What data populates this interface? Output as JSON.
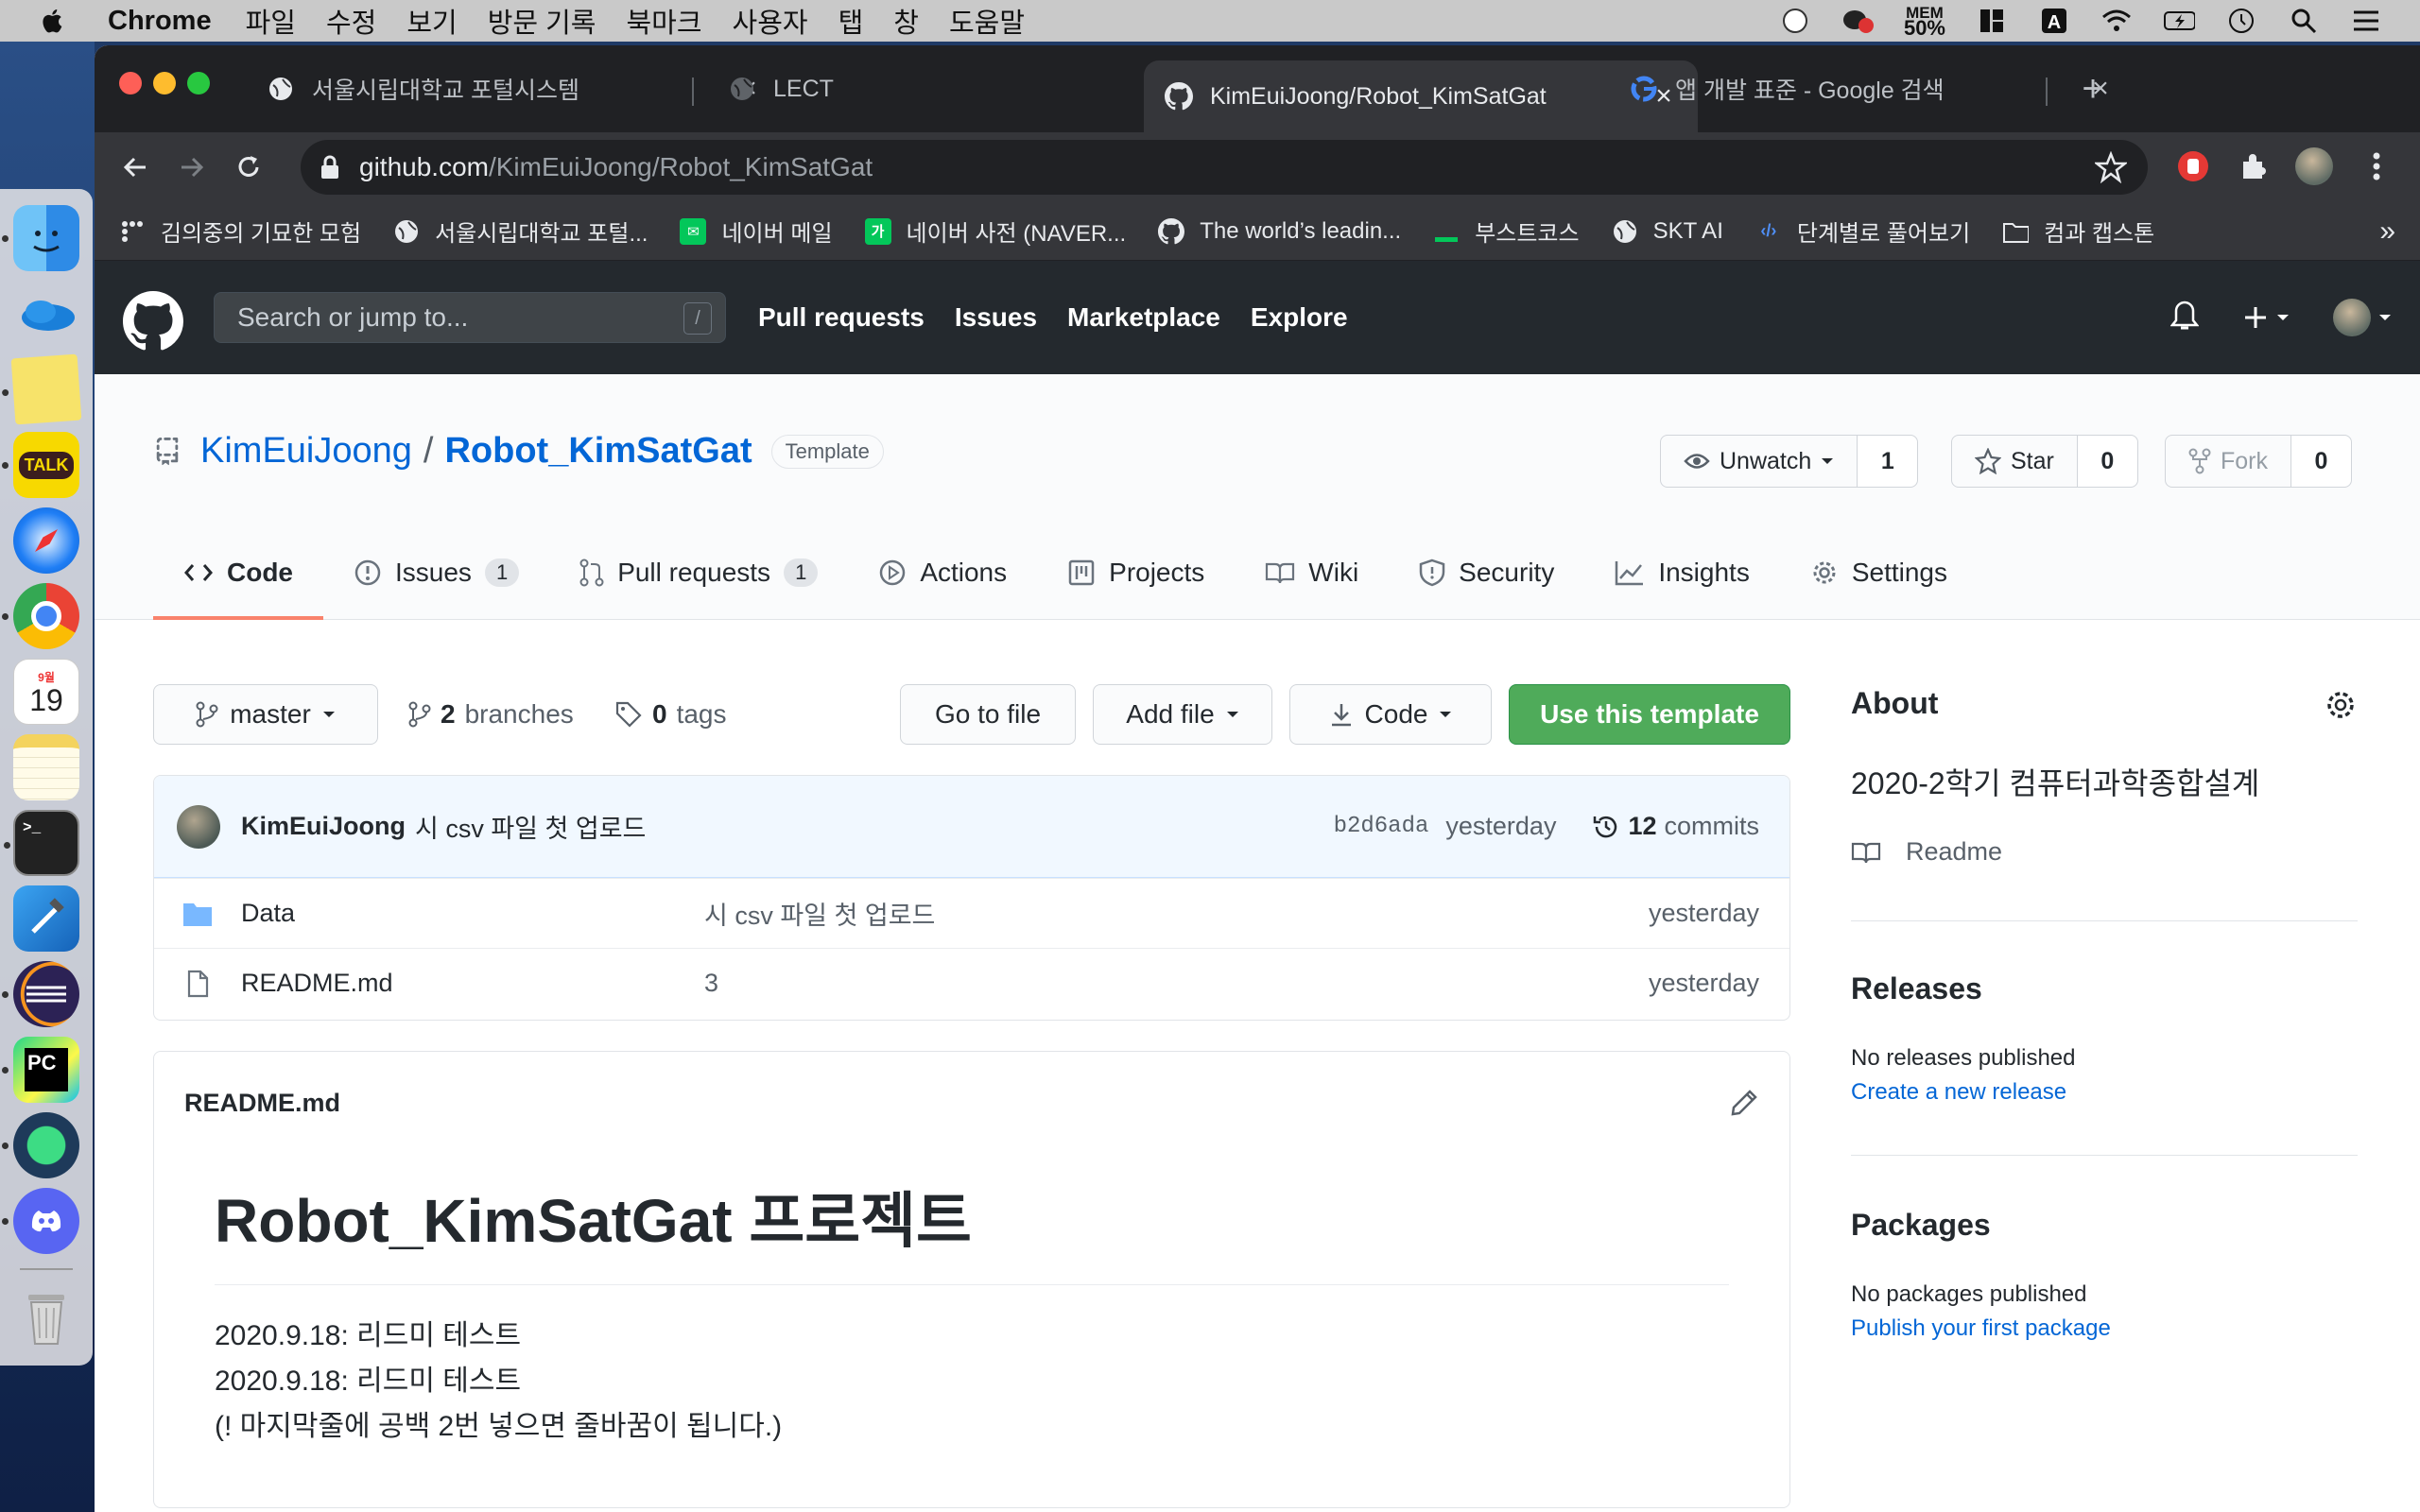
{
  "menubar": {
    "app": "Chrome",
    "items": [
      "파일",
      "수정",
      "보기",
      "방문 기록",
      "북마크",
      "사용자",
      "탭",
      "창",
      "도움말"
    ],
    "mem_label": "MEM",
    "mem_value": "50%"
  },
  "dock": {
    "apps": [
      "finder",
      "onedrive",
      "stickies",
      "kakaotalk",
      "safari",
      "chrome",
      "calendar",
      "notes",
      "terminal",
      "xcode",
      "eclipse",
      "pycharm",
      "android-studio",
      "discord",
      "trash"
    ],
    "calendar_month": "9월",
    "calendar_day": "19",
    "kakao_label": "TALK",
    "pycharm_label": "PC"
  },
  "tabs": [
    {
      "title": "서울시립대학교 포털시스템",
      "icon": "globe-icon"
    },
    {
      "title": "LECT",
      "icon": "globe-icon"
    },
    {
      "title": "KimEuiJoong/Robot_KimSatGat",
      "icon": "github-icon",
      "active": true
    },
    {
      "title": "앱 개발 표준 - Google 검색",
      "icon": "google-icon"
    }
  ],
  "address": {
    "host": "github.com",
    "path": "/KimEuiJoong/Robot_KimSatGat"
  },
  "bookmarks": [
    {
      "label": "김의중의 기묘한 모험",
      "icon": "dots-icon"
    },
    {
      "label": "서울시립대학교 포털...",
      "icon": "globe-icon"
    },
    {
      "label": "네이버 메일",
      "icon": "naver-mail-icon"
    },
    {
      "label": "네이버 사전 (NAVER...",
      "icon": "naver-dict-icon"
    },
    {
      "label": "The world’s leadin...",
      "icon": "github-icon"
    },
    {
      "label": "부스트코스",
      "icon": "boostcourse-icon"
    },
    {
      "label": "SKT AI",
      "icon": "globe-icon"
    },
    {
      "label": "단계별로 풀어보기",
      "icon": "code-icon"
    },
    {
      "label": "컴과 캡스톤",
      "icon": "folder-icon"
    }
  ],
  "bookmarks_more": "»",
  "github": {
    "search_placeholder": "Search or jump to...",
    "search_shortcut": "/",
    "nav": [
      "Pull requests",
      "Issues",
      "Marketplace",
      "Explore"
    ]
  },
  "repo": {
    "owner": "KimEuiJoong",
    "separator": "/",
    "name": "Robot_KimSatGat",
    "badge": "Template",
    "watch_label": "Unwatch",
    "watch_count": "1",
    "star_label": "Star",
    "star_count": "0",
    "fork_label": "Fork",
    "fork_count": "0"
  },
  "repo_tabs": [
    {
      "label": "Code",
      "icon": "code-icon"
    },
    {
      "label": "Issues",
      "icon": "issue-icon",
      "count": "1"
    },
    {
      "label": "Pull requests",
      "icon": "pull-request-icon",
      "count": "1"
    },
    {
      "label": "Actions",
      "icon": "play-icon"
    },
    {
      "label": "Projects",
      "icon": "project-icon"
    },
    {
      "label": "Wiki",
      "icon": "book-icon"
    },
    {
      "label": "Security",
      "icon": "shield-icon"
    },
    {
      "label": "Insights",
      "icon": "graph-icon"
    },
    {
      "label": "Settings",
      "icon": "gear-icon"
    }
  ],
  "filebar": {
    "branch": "master",
    "branches_count": "2",
    "branches_label": "branches",
    "tags_count": "0",
    "tags_label": "tags",
    "goto_file": "Go to file",
    "add_file": "Add file",
    "code": "Code",
    "use_template": "Use this template"
  },
  "commit": {
    "author": "KimEuiJoong",
    "message": "시 csv 파일 첫 업로드",
    "sha": "b2d6ada",
    "age": "yesterday",
    "commits_count": "12",
    "commits_label": "commits"
  },
  "files": [
    {
      "type": "folder",
      "name": "Data",
      "message": "시 csv 파일 첫 업로드",
      "age": "yesterday"
    },
    {
      "type": "file",
      "name": "README.md",
      "message": "3",
      "age": "yesterday"
    }
  ],
  "readme": {
    "filename": "README.md",
    "heading": "Robot_KimSatGat 프로젝트",
    "lines": [
      "2020.9.18: 리드미 테스트",
      "2020.9.18: 리드미 테스트",
      "(! 마지막줄에 공백 2번 넣으면 줄바꿈이 됩니다.)"
    ]
  },
  "sidebar": {
    "about_title": "About",
    "description": "2020-2학기 컴퓨터과학종합설계",
    "readme_link": "Readme",
    "releases_title": "Releases",
    "releases_text": "No releases published",
    "releases_link": "Create a new release",
    "packages_title": "Packages",
    "packages_text": "No packages published",
    "packages_link": "Publish your first package"
  },
  "colors": {
    "accent_link": "#0366d6",
    "header_bg": "#24292e",
    "green_button": "#4fab5a",
    "active_tab_underline": "#f9826c"
  }
}
